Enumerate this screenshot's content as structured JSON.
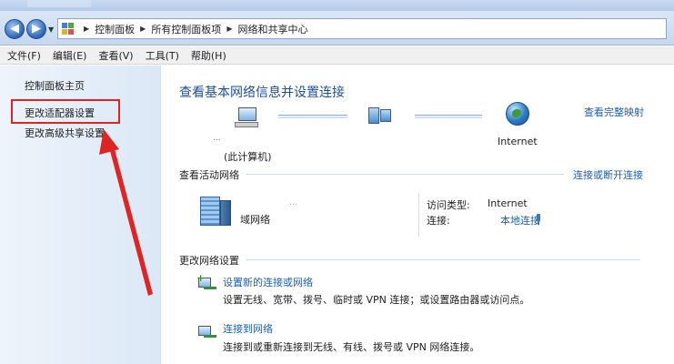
{
  "address_bar": {
    "crumbs": [
      "控制面板",
      "所有控制面板项",
      "网络和共享中心"
    ]
  },
  "menu": [
    "文件(F)",
    "编辑(E)",
    "查看(V)",
    "工具(T)",
    "帮助(H)"
  ],
  "sidebar": {
    "home": "控制面板主页",
    "adapter": "更改适配器设置",
    "sharing": "更改高级共享设置"
  },
  "main": {
    "heading": "查看基本网络信息并设置连接",
    "full_map": "查看完整映射",
    "map": {
      "pc_dots": "...",
      "pc_label": "(此计算机)",
      "internet_label": "Internet"
    },
    "active": {
      "title": "查看活动网络",
      "connect_link": "连接或断开连接",
      "net_dots": "...",
      "network_name": "域网络",
      "access_type_label": "访问类型:",
      "access_type_value": "Internet",
      "connection_label": "连接:",
      "connection_value": "本地连接"
    },
    "change": {
      "title": "更改网络设置",
      "tasks": [
        {
          "title": "设置新的连接或网络",
          "desc": "设置无线、宽带、拨号、临时或 VPN 连接；或设置路由器或访问点。"
        },
        {
          "title": "连接到网络",
          "desc": "连接到或重新连接到无线、有线、拨号或 VPN 网络连接。"
        }
      ]
    }
  },
  "colors": {
    "link": "#1a5fb4",
    "heading": "#1c4e9c",
    "annotation": "#e02424"
  }
}
